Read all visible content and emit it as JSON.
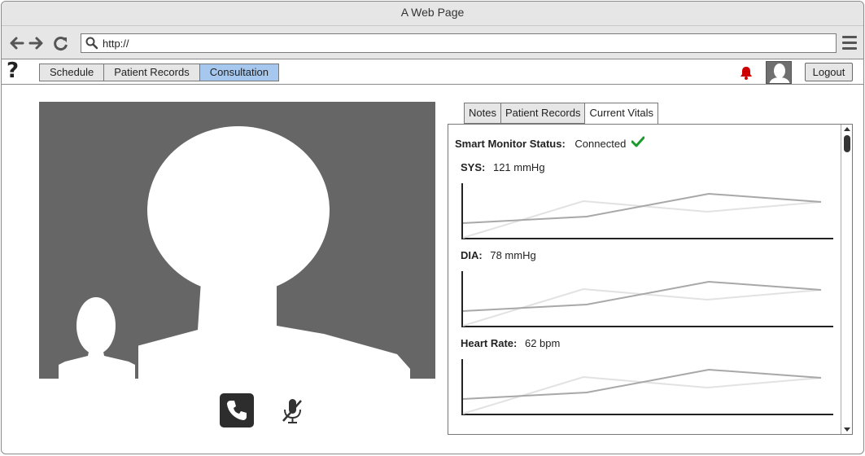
{
  "window": {
    "title": "A Web Page"
  },
  "browser": {
    "url": "http://"
  },
  "nav": {
    "help_symbol": "?",
    "tabs": [
      {
        "label": "Schedule",
        "active": false
      },
      {
        "label": "Patient Records",
        "active": false
      },
      {
        "label": "Consultation",
        "active": true
      }
    ],
    "logout_label": "Logout"
  },
  "panel": {
    "tabs": [
      {
        "label": "Notes",
        "active": false
      },
      {
        "label": "Patient Records",
        "active": false
      },
      {
        "label": "Current Vitals",
        "active": true
      }
    ],
    "status_label": "Smart Monitor Status:",
    "status_value": "Connected",
    "vitals": [
      {
        "label": "SYS:",
        "value": "121 mmHg"
      },
      {
        "label": "DIA:",
        "value": "78 mmHg"
      },
      {
        "label": "Heart Rate:",
        "value": "62 bpm"
      }
    ]
  },
  "colors": {
    "active_tab": "#a6c8ef",
    "bell": "#cc0000",
    "check": "#1a9a2a",
    "video_bg": "#666666"
  },
  "icons": [
    "back-arrow-icon",
    "forward-arrow-icon",
    "reload-icon",
    "search-icon",
    "hamburger-menu-icon",
    "help-icon",
    "notification-bell-icon",
    "user-avatar-icon",
    "phone-icon",
    "mute-mic-icon",
    "checkmark-icon"
  ]
}
